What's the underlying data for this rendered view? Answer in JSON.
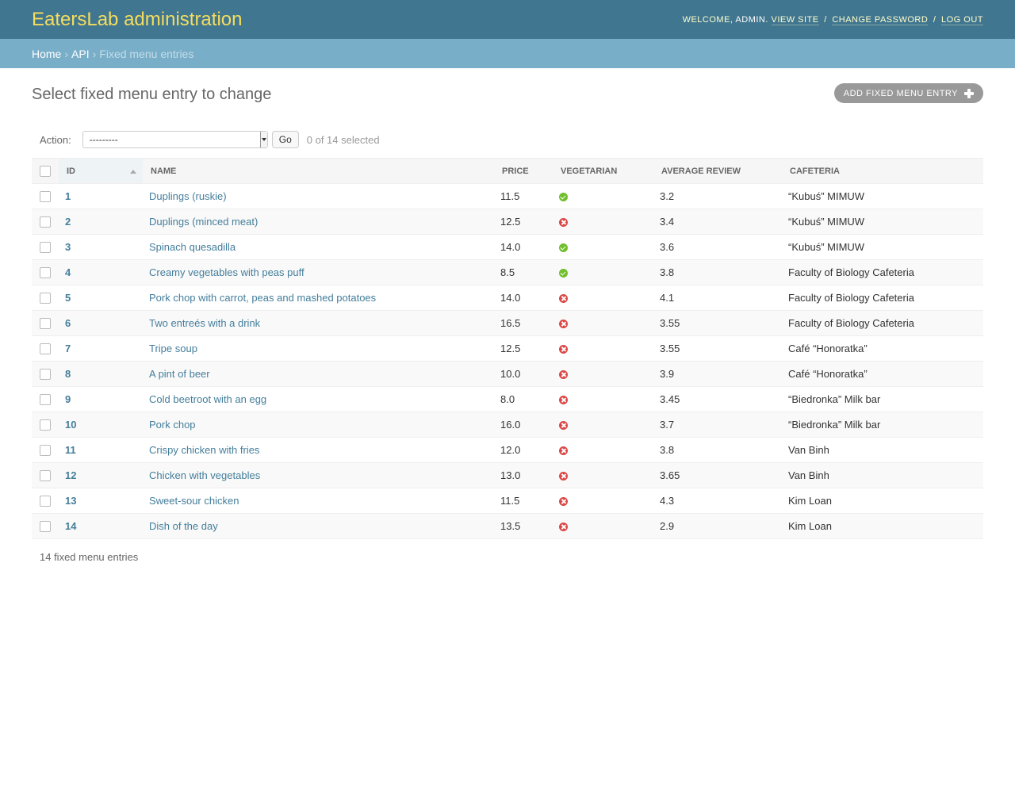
{
  "header": {
    "branding": "EatersLab administration",
    "welcome": "Welcome,",
    "user": "admin",
    "view_site": "View site",
    "change_password": "Change password",
    "log_out": "Log out"
  },
  "breadcrumbs": {
    "home": "Home",
    "app": "API",
    "current": "Fixed menu entries"
  },
  "page_title": "Select fixed menu entry to change",
  "add_button": "Add fixed menu entry",
  "actions": {
    "label": "Action:",
    "selected_value": "---------",
    "go": "Go",
    "counter": "0 of 14 selected"
  },
  "columns": {
    "id": "ID",
    "name": "Name",
    "price": "Price",
    "vegetarian": "Vegetarian",
    "average_review": "Average review",
    "cafeteria": "Cafeteria"
  },
  "rows": [
    {
      "id": "1",
      "name": "Duplings (ruskie)",
      "price": "11.5",
      "vegetarian": "yes",
      "review": "3.2",
      "cafeteria": "“Kubuś” MIMUW"
    },
    {
      "id": "2",
      "name": "Duplings (minced meat)",
      "price": "12.5",
      "vegetarian": "no",
      "review": "3.4",
      "cafeteria": "“Kubuś” MIMUW"
    },
    {
      "id": "3",
      "name": "Spinach quesadilla",
      "price": "14.0",
      "vegetarian": "yes",
      "review": "3.6",
      "cafeteria": "“Kubuś” MIMUW"
    },
    {
      "id": "4",
      "name": "Creamy vegetables with peas puff",
      "price": "8.5",
      "vegetarian": "yes",
      "review": "3.8",
      "cafeteria": "Faculty of Biology Cafeteria"
    },
    {
      "id": "5",
      "name": "Pork chop with carrot, peas and mashed potatoes",
      "price": "14.0",
      "vegetarian": "no",
      "review": "4.1",
      "cafeteria": "Faculty of Biology Cafeteria"
    },
    {
      "id": "6",
      "name": "Two entreés with a drink",
      "price": "16.5",
      "vegetarian": "no",
      "review": "3.55",
      "cafeteria": "Faculty of Biology Cafeteria"
    },
    {
      "id": "7",
      "name": "Tripe soup",
      "price": "12.5",
      "vegetarian": "no",
      "review": "3.55",
      "cafeteria": "Café “Honoratka”"
    },
    {
      "id": "8",
      "name": "A pint of beer",
      "price": "10.0",
      "vegetarian": "no",
      "review": "3.9",
      "cafeteria": "Café “Honoratka”"
    },
    {
      "id": "9",
      "name": "Cold beetroot with an egg",
      "price": "8.0",
      "vegetarian": "no",
      "review": "3.45",
      "cafeteria": "“Biedronka” Milk bar"
    },
    {
      "id": "10",
      "name": "Pork chop",
      "price": "16.0",
      "vegetarian": "no",
      "review": "3.7",
      "cafeteria": "“Biedronka” Milk bar"
    },
    {
      "id": "11",
      "name": "Crispy chicken with fries",
      "price": "12.0",
      "vegetarian": "no",
      "review": "3.8",
      "cafeteria": "Van Binh"
    },
    {
      "id": "12",
      "name": "Chicken with vegetables",
      "price": "13.0",
      "vegetarian": "no",
      "review": "3.65",
      "cafeteria": "Van Binh"
    },
    {
      "id": "13",
      "name": "Sweet-sour chicken",
      "price": "11.5",
      "vegetarian": "no",
      "review": "4.3",
      "cafeteria": "Kim Loan"
    },
    {
      "id": "14",
      "name": "Dish of the day",
      "price": "13.5",
      "vegetarian": "no",
      "review": "2.9",
      "cafeteria": "Kim Loan"
    }
  ],
  "footer_count": "14 fixed menu entries",
  "colors": {
    "header_bg": "#417690",
    "breadcrumbs_bg": "#79aec8",
    "branding": "#f5dd5d",
    "link": "#447e9b",
    "yes": "#70bf2b",
    "no": "#dd4646"
  }
}
